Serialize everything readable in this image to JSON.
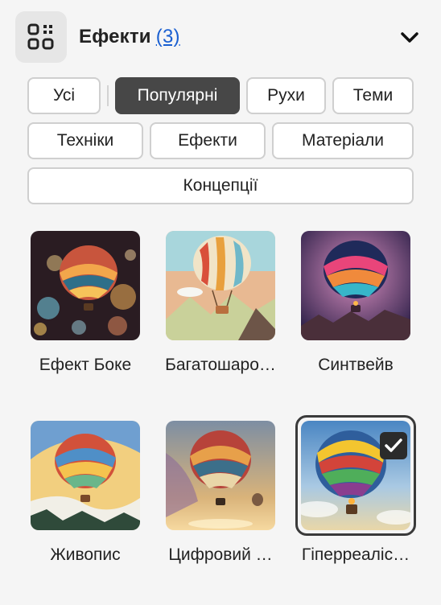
{
  "header": {
    "title": "Ефекти",
    "count": "(3)",
    "icon": "effects-grid-icon",
    "toggle_icon": "chevron-down-icon"
  },
  "filters": {
    "active": "Популярні",
    "chips": [
      "Усі",
      "Популярні",
      "Рухи",
      "Теми",
      "Техніки",
      "Ефекти",
      "Матеріали",
      "Концепції"
    ]
  },
  "styles": [
    {
      "label": "Ефект Боке",
      "selected": false
    },
    {
      "label": "Багатошаро…",
      "selected": false
    },
    {
      "label": "Синтвейв",
      "selected": false
    },
    {
      "label": "Живопис",
      "selected": false
    },
    {
      "label": "Цифровий …",
      "selected": false
    },
    {
      "label": "Гіперреаліс…",
      "selected": true
    }
  ],
  "colors": {
    "accent_link": "#1a5fd1",
    "chip_active_bg": "#474747",
    "background": "#f5f5f5"
  }
}
